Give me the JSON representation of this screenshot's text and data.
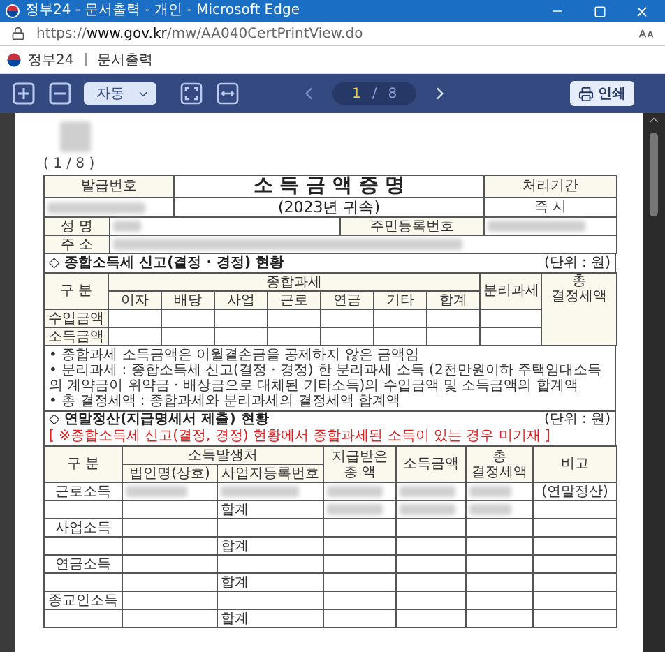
{
  "window": {
    "title": "정부24 - 문서출력 - 개인 - Microsoft Edge"
  },
  "address_bar": {
    "url": "https://**www.gov.kr**/mw/AA040CertPrintView.do"
  },
  "app_header": {
    "brand": "정부24",
    "section": "문서출력"
  },
  "toolbar": {
    "zoom_mode": "자동",
    "page_current": "1",
    "page_separator": "/",
    "page_total": "8",
    "print_label": "인쇄"
  },
  "document": {
    "page_marker": "( 1 / 8 )",
    "redacted": {
      "code": true,
      "issue_number": true,
      "name": true,
      "id_number": true,
      "address": true
    },
    "header": {
      "issue_number_label": "발급번호",
      "title": "소 득 금 액 증 명",
      "subtitle": "(2023년 귀속)",
      "processing_label": "처리기간",
      "processing_value": "즉 시",
      "name_label": "성 명",
      "id_label": "주민등록번호",
      "address_label": "주 소"
    },
    "section1": {
      "heading": "◇ 종합소득세 신고(결정 · 경정) 현황",
      "unit": "(단위 : 원)",
      "col_category": "구 분",
      "col_group": "종합과세",
      "subcolumns": [
        "이자",
        "배당",
        "사업",
        "근로",
        "연금",
        "기타",
        "합계"
      ],
      "col_separate": "분리과세",
      "col_total": "총 결정세액",
      "rows": [
        "수입금액",
        "소득금액"
      ],
      "notes": [
        "• 종합과세 소득금액은 이월결손금을 공제하지 않은 금액임",
        "• 분리과세 : 종합소득세 신고(결정 · 경정) 한 분리과세 소득 (2천만원이하 주택임대소득의 계약금이 위약금 · 배상금으로 대체된 기타소득)의 수입금액 및 소득금액의 합계액",
        "• 총 결정세액 : 종합과세와 분리과세의 결정세액 합계액"
      ]
    },
    "section2": {
      "heading": "◇ 연말정산(지급명세서 제출) 현황",
      "notice": "[ ※종합소득세 신고(결정, 경정) 현황에서 종합과세된 소득이 있는 경우 미기재 ]",
      "unit": "(단위 : 원)",
      "col_category": "구 분",
      "col_group": "소득발생처",
      "subcolumns": [
        "법인명(상호)",
        "사업자등록번호"
      ],
      "columns": [
        "지급받은 총 액",
        "소득금액",
        "총 결정세액",
        "비고"
      ],
      "rows": [
        {
          "kind": "income",
          "label": "근로소득",
          "redacted": true,
          "note": "(연말정산)"
        },
        {
          "kind": "subtotal",
          "label": "합계",
          "redacted": true
        },
        {
          "kind": "income",
          "label": "사업소득",
          "redacted": false
        },
        {
          "kind": "subtotal",
          "label": "합계",
          "redacted": false
        },
        {
          "kind": "income",
          "label": "연금소득",
          "redacted": false
        },
        {
          "kind": "subtotal",
          "label": "합계",
          "redacted": false
        },
        {
          "kind": "income",
          "label": "종교인소득",
          "redacted": false
        },
        {
          "kind": "subtotal",
          "label": "합계",
          "redacted": false
        }
      ]
    }
  }
}
